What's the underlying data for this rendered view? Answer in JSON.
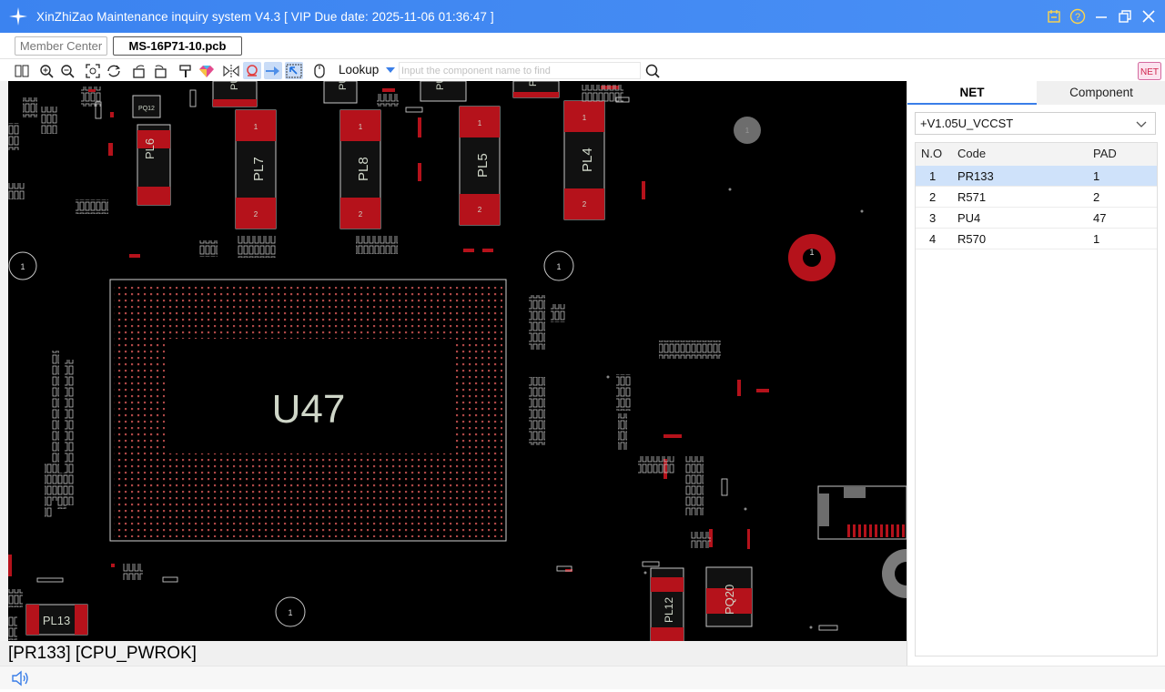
{
  "window": {
    "title": "XinZhiZao Maintenance inquiry system V4.3 [ VIP Due date: 2025-11-06 01:36:47 ]"
  },
  "tabs": {
    "member": "Member Center",
    "file": "MS-16P71-10.pcb"
  },
  "toolbar": {
    "lookup_label": "Lookup",
    "search_placeholder": "Input the component name to find",
    "net_badge": "NET"
  },
  "board": {
    "main_chip": "U47",
    "pad_1": "1",
    "pad_2": "2",
    "components": [
      "PL6",
      "PL7",
      "PL8",
      "PL5",
      "PL4",
      "PL13",
      "PL12",
      "PQ20",
      "PQ12",
      "PU",
      "PU",
      "PU",
      "PU"
    ],
    "colors": {
      "background": "#000000",
      "pad": "#b5121b",
      "silkscreen": "#cfd6c8"
    }
  },
  "status_text": "[PR133] [CPU_PWROK]",
  "panel": {
    "tabs": [
      "NET",
      "Component"
    ],
    "active_tab": "NET",
    "net_selected": "+V1.05U_VCCST",
    "columns": {
      "no": "N.O",
      "code": "Code",
      "pad": "PAD"
    },
    "rows": [
      {
        "no": "1",
        "code": "PR133",
        "pad": "1"
      },
      {
        "no": "2",
        "code": "R571",
        "pad": "2"
      },
      {
        "no": "3",
        "code": "PU4",
        "pad": "47"
      },
      {
        "no": "4",
        "code": "R570",
        "pad": "1"
      }
    ]
  }
}
